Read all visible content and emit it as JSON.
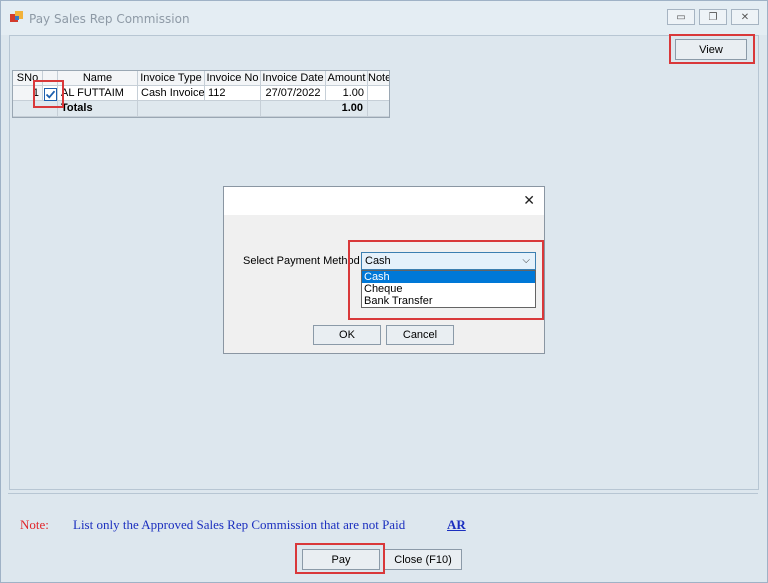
{
  "window": {
    "title": "Pay Sales Rep Commission",
    "controls": {
      "minimize": "▭",
      "restore": "❐",
      "close": "✕"
    }
  },
  "toolbar": {
    "view_label": "View"
  },
  "grid": {
    "columns": [
      "SNo",
      "Name",
      "Invoice Type",
      "Invoice No",
      "Invoice Date",
      "Amount",
      "Notes"
    ],
    "rows": [
      {
        "sno": "1",
        "checked": true,
        "name": "AL FUTTAIM",
        "invoice_type": "Cash Invoice",
        "invoice_no": "112",
        "invoice_date": "27/07/2022",
        "amount": "1.00",
        "notes": ""
      }
    ],
    "totals": {
      "label": "Totals",
      "amount": "1.00"
    }
  },
  "dialog": {
    "close_glyph": "✕",
    "payment_method_label": "Select Payment Method",
    "selected_value": "Cash",
    "options": [
      "Cash",
      "Cheque",
      "Bank Transfer"
    ],
    "ok_label": "OK",
    "cancel_label": "Cancel"
  },
  "note": {
    "label": "Note:",
    "text": "List only the Approved Sales Rep Commission that are not Paid",
    "link": "AR"
  },
  "actions": {
    "pay_label": "Pay",
    "close_label": "Close (F10)"
  },
  "colors": {
    "highlight": "#d9383a",
    "selection": "#0078d7",
    "note_red": "#e1252a",
    "note_blue": "#1b2fbf"
  }
}
